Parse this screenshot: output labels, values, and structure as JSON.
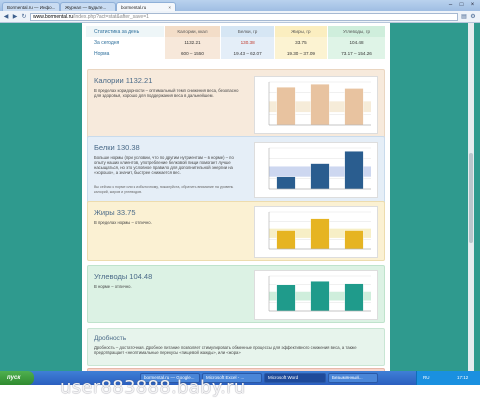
{
  "browser": {
    "tabs": [
      {
        "label": "Bormental.ru — Инфо..."
      },
      {
        "label": "Журнал — Будьте..."
      },
      {
        "label": "bormental.ru"
      }
    ],
    "url_domain": "www.bormental.ru",
    "url_path": "/index.php?act=stat&after_save=1"
  },
  "summary": {
    "header_label": "Статистика за день",
    "columns": [
      "Калории, ккал",
      "Белки, гр",
      "Жиры, гр",
      "Углеводы, гр"
    ],
    "rows": [
      {
        "label": "За сегодня",
        "values": [
          "1132.21",
          "130.38",
          "33.75",
          "104.48"
        ]
      },
      {
        "label": "Норма",
        "values": [
          "600 – 1550",
          "19.43 – 62.07",
          "19.30 – 37.09",
          "73.17 – 154.26"
        ]
      }
    ]
  },
  "panels": {
    "calories": {
      "title": "Калории 1132.21",
      "text": "В пределах коридорности – оптимальный темп снижения веса, безопасно для здоровья, хорошо для поддержания веса в дальнейшем."
    },
    "protein": {
      "title": "Белки 130.38",
      "text": "Больше нормы (при условии, что по другим нутриентам – в норме) – по опыту наших клиентов, употребление белковой пищи помогает лучше насыщаться, но это условное правило для дополнительной энергии на «хорошо», а значит, быстрее снижается вес.",
      "note": "Вы сейчас к норме или к избыточному, пожалуйста, обратить внимание на уровень калорий, жиров и углеводов."
    },
    "fat": {
      "title": "Жиры 33.75",
      "text": "В пределах нормы – отлично."
    },
    "carbs": {
      "title": "Углеводы 104.48",
      "text": "В норме – отлично."
    },
    "drob": {
      "title": "Дробность",
      "text": "Дробность – достаточная. Дробное питание позволяет стимулировать обменные процессы для эффективного снижения веса, а также предотвращает «неоптимальные перекусы «пищевой жажды», или «жора»"
    }
  },
  "chart_data": [
    {
      "type": "bar",
      "name": "calories",
      "colors": {
        "bar": "#e8c3a0",
        "band": "#f6ecd9"
      },
      "values": [
        0.88,
        0.95,
        0.85
      ]
    },
    {
      "type": "bar",
      "name": "protein",
      "colors": {
        "bar": "#2a5d8f",
        "band": "#cdd7f0"
      },
      "values": [
        0.3,
        0.62,
        0.92
      ]
    },
    {
      "type": "bar",
      "name": "fat",
      "colors": {
        "bar": "#e6b422",
        "band": "#f7efc6"
      },
      "data_labels": [
        "",
        "",
        ""
      ],
      "values": [
        0.5,
        0.82,
        0.5
      ]
    },
    {
      "type": "bar",
      "name": "carbs",
      "colors": {
        "bar": "#1f9b8b",
        "band": "#cfeedc"
      },
      "values": [
        0.75,
        0.85,
        0.78
      ]
    }
  ],
  "taskbar": {
    "start": "пуск",
    "items": [
      {
        "label": "bormental.ru — Google..."
      },
      {
        "label": "Microsoft Excel - ..."
      },
      {
        "label": "Microsoft Word"
      },
      {
        "label": "Безымянный..."
      }
    ],
    "lang": "RU",
    "clock": "17:12"
  },
  "watermark": "user883888.baby.ru"
}
